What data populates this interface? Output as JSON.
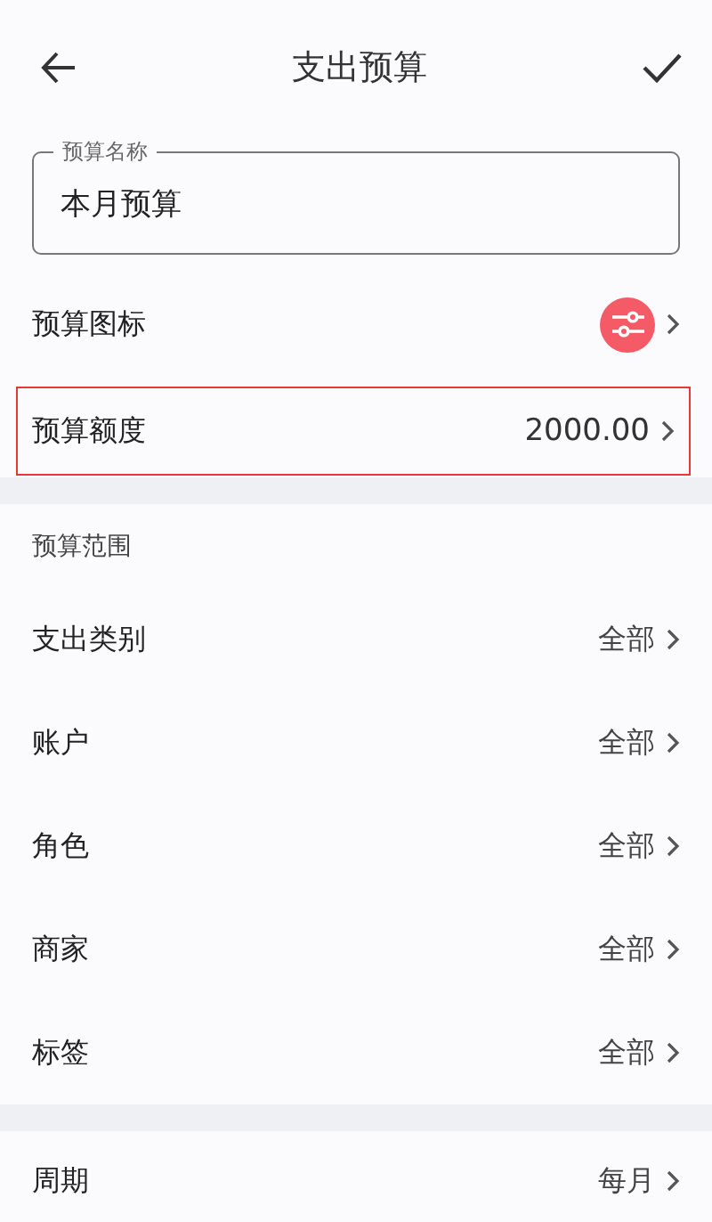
{
  "header": {
    "title": "支出预算"
  },
  "name_field": {
    "label": "预算名称",
    "value": "本月预算"
  },
  "icon_row": {
    "label": "预算图标",
    "color": "#f45b66"
  },
  "amount_row": {
    "label": "预算额度",
    "value": "2000.00",
    "highlighted": true
  },
  "scope": {
    "title": "预算范围",
    "rows": [
      {
        "label": "支出类别",
        "value": "全部"
      },
      {
        "label": "账户",
        "value": "全部"
      },
      {
        "label": "角色",
        "value": "全部"
      },
      {
        "label": "商家",
        "value": "全部"
      },
      {
        "label": "标签",
        "value": "全部"
      }
    ]
  },
  "period_row": {
    "label": "周期",
    "value": "每月"
  }
}
